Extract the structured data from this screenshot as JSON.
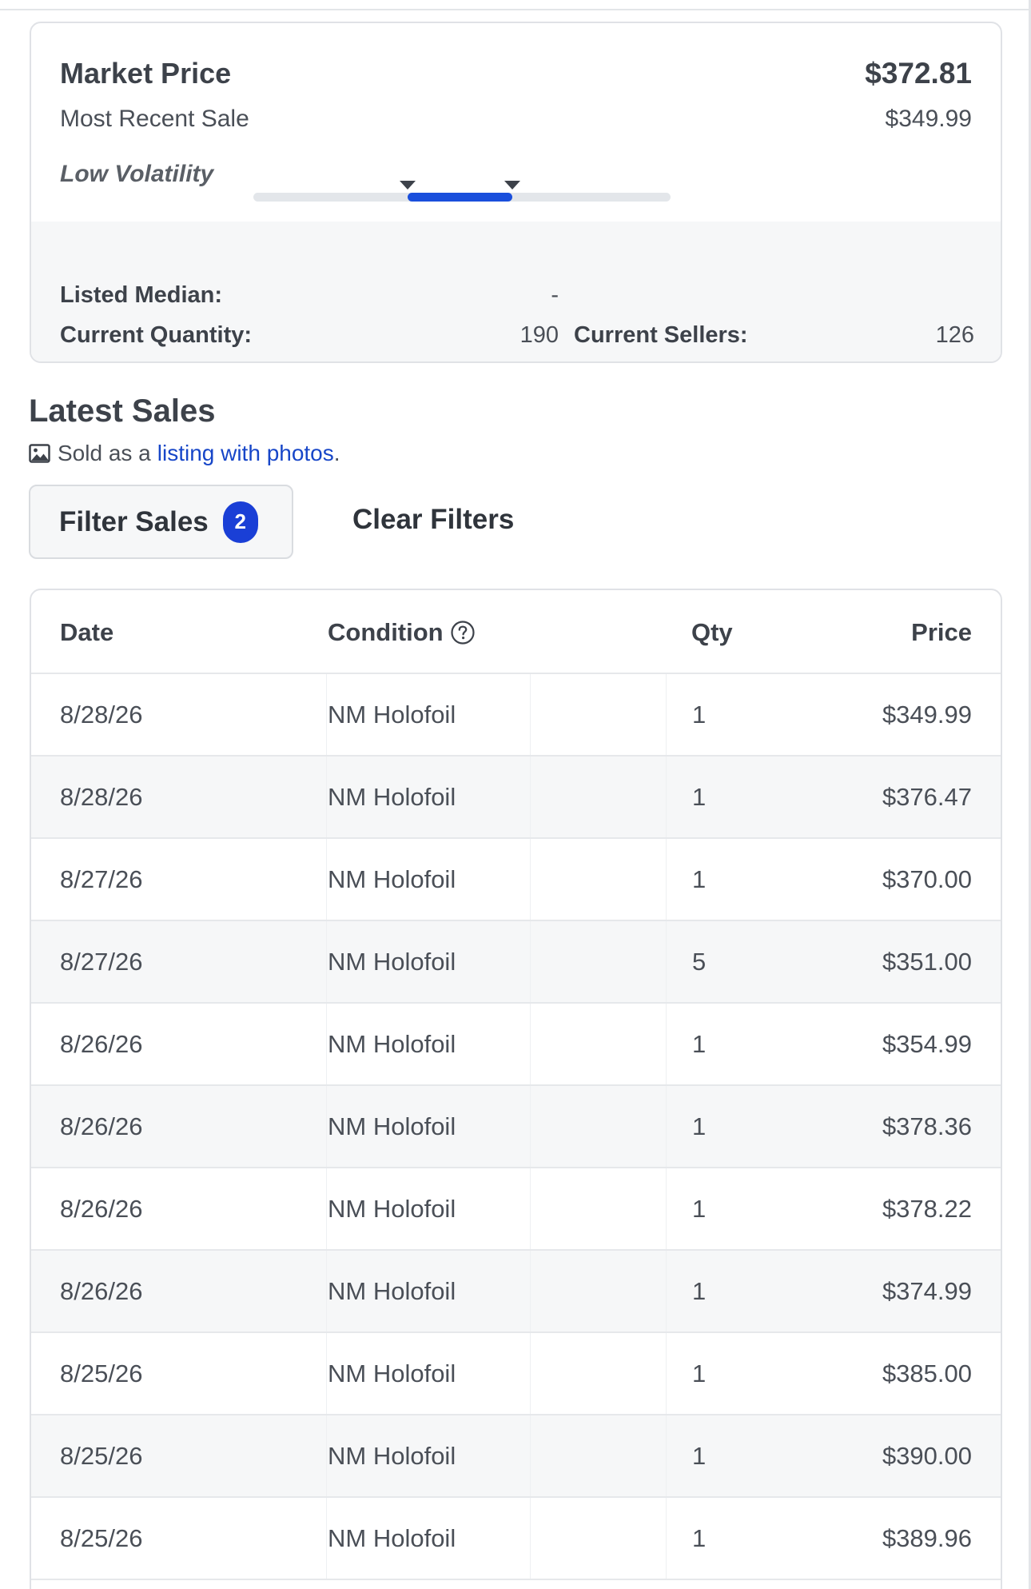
{
  "market": {
    "market_price_label": "Market Price",
    "market_price_value": "$372.81",
    "recent_sale_label": "Most Recent Sale",
    "recent_sale_value": "$349.99",
    "volatility_label": "Low Volatility",
    "volatility_range": [
      0.37,
      0.62
    ]
  },
  "stats": {
    "listed_median_label": "Listed Median:",
    "listed_median_value": "-",
    "current_quantity_label": "Current Quantity:",
    "current_quantity_value": "190",
    "current_sellers_label": "Current Sellers:",
    "current_sellers_value": "126"
  },
  "latest_sales": {
    "title": "Latest Sales",
    "note_prefix": "Sold as a",
    "note_link": "listing with photos",
    "note_suffix": ".",
    "photo_icon": "image-icon",
    "filter_label": "Filter Sales",
    "filter_count": "2",
    "clear_label": "Clear Filters"
  },
  "table": {
    "headers": {
      "date": "Date",
      "condition": "Condition",
      "qty": "Qty",
      "price": "Price"
    },
    "help_icon": "question-circle-icon",
    "rows": [
      {
        "date": "8/28/26",
        "condition": "NM Holofoil",
        "qty": "1",
        "price": "$349.99"
      },
      {
        "date": "8/28/26",
        "condition": "NM Holofoil",
        "qty": "1",
        "price": "$376.47"
      },
      {
        "date": "8/27/26",
        "condition": "NM Holofoil",
        "qty": "1",
        "price": "$370.00"
      },
      {
        "date": "8/27/26",
        "condition": "NM Holofoil",
        "qty": "5",
        "price": "$351.00"
      },
      {
        "date": "8/26/26",
        "condition": "NM Holofoil",
        "qty": "1",
        "price": "$354.99"
      },
      {
        "date": "8/26/26",
        "condition": "NM Holofoil",
        "qty": "1",
        "price": "$378.36"
      },
      {
        "date": "8/26/26",
        "condition": "NM Holofoil",
        "qty": "1",
        "price": "$378.22"
      },
      {
        "date": "8/26/26",
        "condition": "NM Holofoil",
        "qty": "1",
        "price": "$374.99"
      },
      {
        "date": "8/25/26",
        "condition": "NM Holofoil",
        "qty": "1",
        "price": "$385.00"
      },
      {
        "date": "8/25/26",
        "condition": "NM Holofoil",
        "qty": "1",
        "price": "$390.00"
      },
      {
        "date": "8/25/26",
        "condition": "NM Holofoil",
        "qty": "1",
        "price": "$389.96"
      }
    ]
  },
  "colors": {
    "accent": "#1a3fd6",
    "link": "#1746c8",
    "text": "#3d424a",
    "row_alt": "#f6f7f8"
  }
}
